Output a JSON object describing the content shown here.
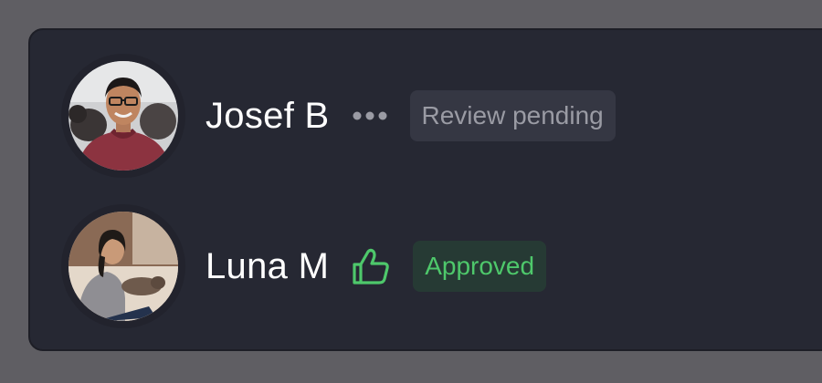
{
  "reviewers": [
    {
      "name": "Josef B",
      "status_icon": "ellipsis-icon",
      "status_label": "Review pending",
      "status_color": "#9a9ba4"
    },
    {
      "name": "Luna M",
      "status_icon": "thumbs-up-icon",
      "status_label": "Approved",
      "status_color": "#4ec86b"
    }
  ],
  "colors": {
    "page_background": "#5f5e63",
    "panel_background": "#262833",
    "pending_badge_background": "#353743",
    "approved_badge_background": "#263a34",
    "approved_accent": "#4ec86b"
  }
}
